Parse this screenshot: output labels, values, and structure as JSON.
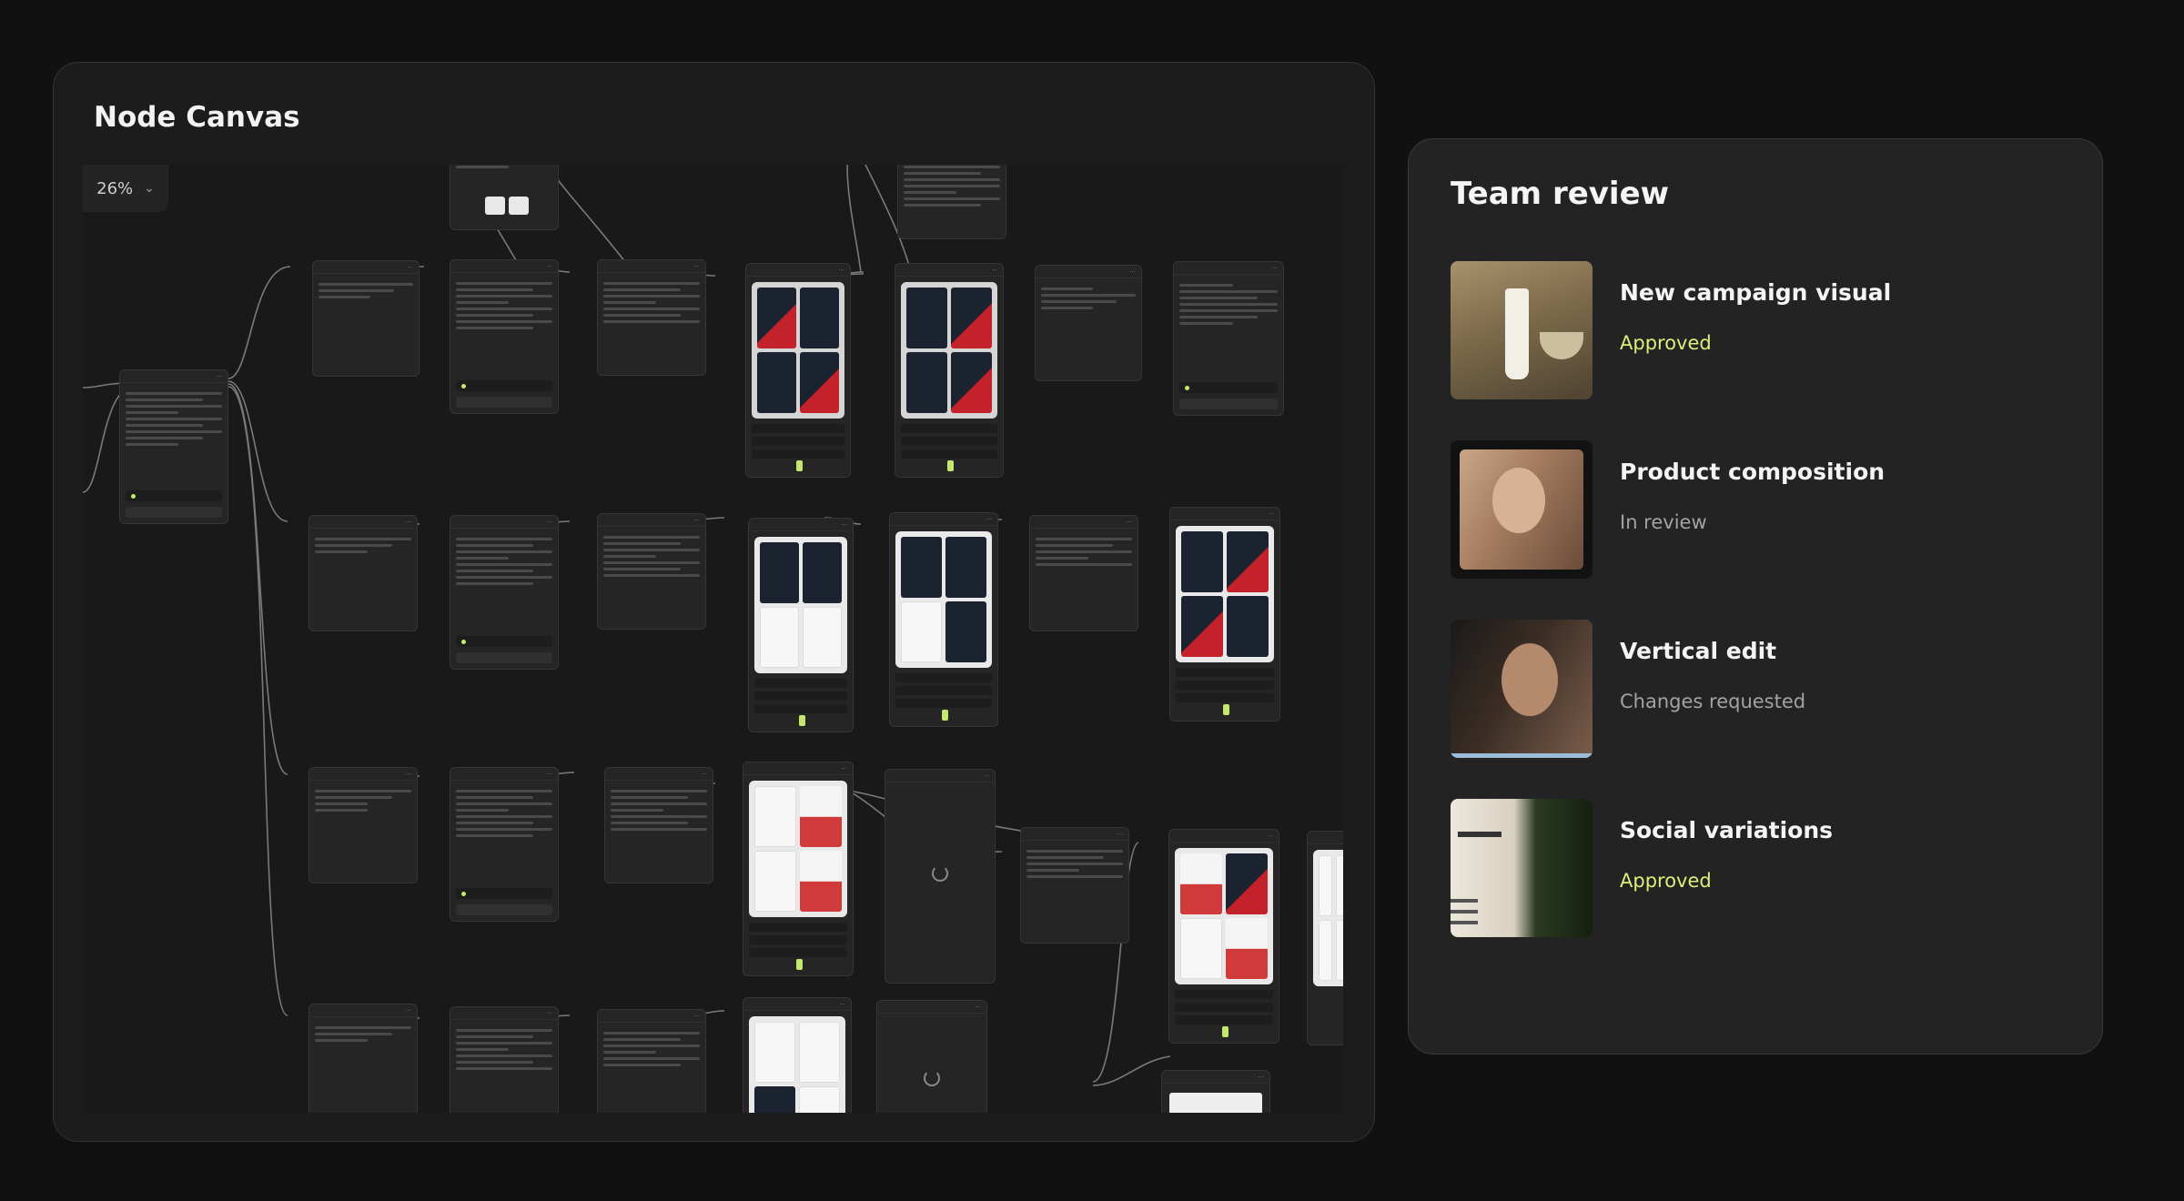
{
  "canvas": {
    "title": "Node Canvas",
    "zoom": "26%"
  },
  "review": {
    "title": "Team review",
    "items": [
      {
        "name": "New campaign visual",
        "status": "Approved",
        "status_color": "#d9f07a",
        "thumb_icon": "product-bottle-image"
      },
      {
        "name": "Product composition",
        "status": "In review",
        "status_color": "#a3a3a3",
        "thumb_icon": "portrait-image"
      },
      {
        "name": "Vertical edit",
        "status": "Changes requested",
        "status_color": "#a3a3a3",
        "thumb_icon": "portrait-image"
      },
      {
        "name": "Social variations",
        "status": "Approved",
        "status_color": "#d9f07a",
        "thumb_icon": "product-bottle-image"
      }
    ]
  },
  "colors": {
    "accent": "#c4e86e",
    "panel": "#1c1c1c",
    "background": "#111111"
  }
}
